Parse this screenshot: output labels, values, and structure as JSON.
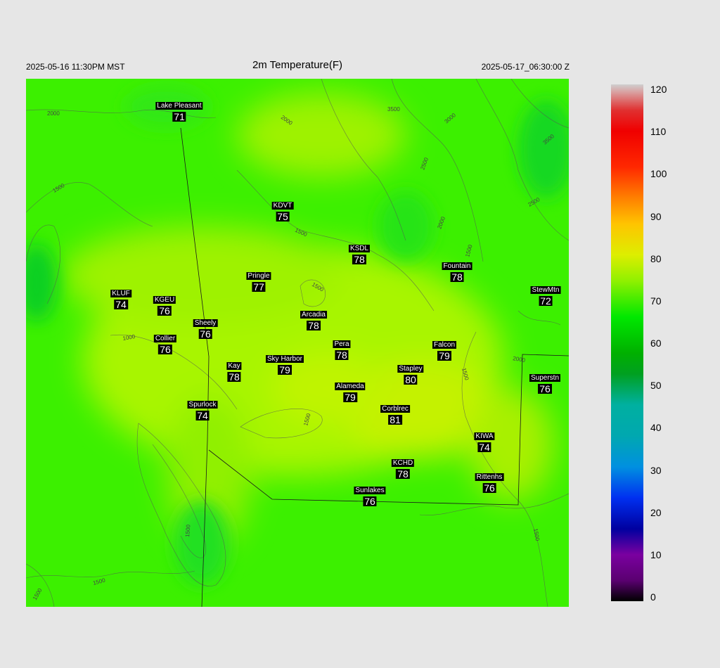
{
  "header": {
    "left": "2025-05-16 11:30PM MST",
    "title": "2m Temperature(F)",
    "right": "2025-05-17_06:30:00 Z"
  },
  "stations": [
    {
      "name": "Lake Pleasant",
      "value": "71"
    },
    {
      "name": "KDVT",
      "value": "75"
    },
    {
      "name": "KSDL",
      "value": "78"
    },
    {
      "name": "Fountain",
      "value": "78"
    },
    {
      "name": "Pringle",
      "value": "77"
    },
    {
      "name": "StewMtn",
      "value": "72"
    },
    {
      "name": "KLUF",
      "value": "74"
    },
    {
      "name": "KGEU",
      "value": "76"
    },
    {
      "name": "Arcadia",
      "value": "78"
    },
    {
      "name": "Sheely",
      "value": "76"
    },
    {
      "name": "Collier",
      "value": "76"
    },
    {
      "name": "Pera",
      "value": "78"
    },
    {
      "name": "Falcon",
      "value": "79"
    },
    {
      "name": "Sky Harbor",
      "value": "79"
    },
    {
      "name": "Kay",
      "value": "78"
    },
    {
      "name": "Stapley",
      "value": "80"
    },
    {
      "name": "Superstn",
      "value": "76"
    },
    {
      "name": "Alameda",
      "value": "79"
    },
    {
      "name": "Spurlock",
      "value": "74"
    },
    {
      "name": "Corblrec",
      "value": "81"
    },
    {
      "name": "KIWA",
      "value": "74"
    },
    {
      "name": "KCHD",
      "value": "78"
    },
    {
      "name": "Rittenhs",
      "value": "76"
    },
    {
      "name": "Sunlakes",
      "value": "76"
    }
  ],
  "contour_labels": [
    "2000",
    "1500",
    "2000",
    "2500",
    "3500",
    "3000",
    "3500",
    "2500",
    "2000",
    "1500",
    "1500",
    "1500",
    "1000",
    "2000",
    "1500",
    "1500",
    "1500",
    "1500",
    "1500",
    "1500"
  ],
  "colorbar": {
    "ticks": [
      "120",
      "110",
      "100",
      "90",
      "80",
      "70",
      "60",
      "50",
      "40",
      "30",
      "20",
      "10",
      "0"
    ],
    "min": 0,
    "max": 120
  },
  "colors": {
    "background": "#e6e6e6",
    "map_base": "#3cf000",
    "warm_zone": "#a6f500",
    "hot_zone": "#c4f200",
    "cool_zone": "#10d020"
  }
}
